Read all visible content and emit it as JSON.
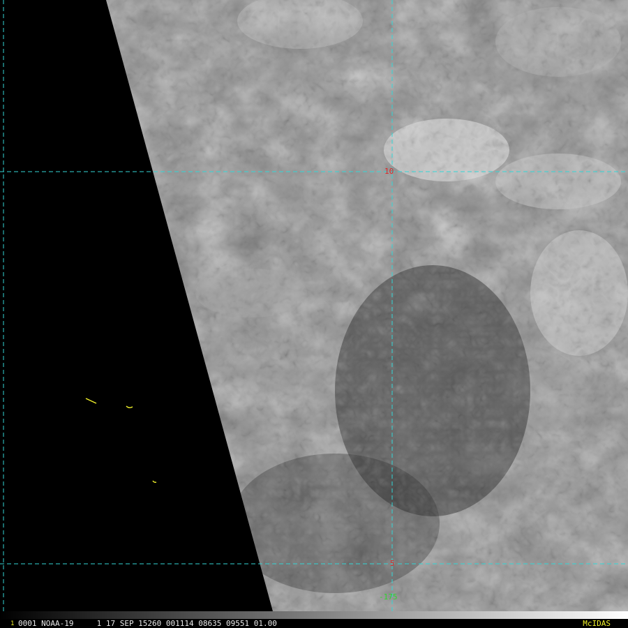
{
  "colors": {
    "grid": "#33d6d6",
    "lat_label": "#e02424",
    "lon_label": "#2fd62f",
    "coast": "#f2f22a",
    "status_text": "#e8e8e8",
    "brand": "#f2f22a",
    "frame_num": "#f2f22a"
  },
  "grid": {
    "lat_labels": [
      "10",
      "5"
    ],
    "lon_labels": [
      "-175"
    ]
  },
  "status": {
    "frame": "1",
    "text": "0001 NOAA-19     1 17 SEP 15260 001114 08635 09551 01.00",
    "brand": "McIDAS"
  }
}
